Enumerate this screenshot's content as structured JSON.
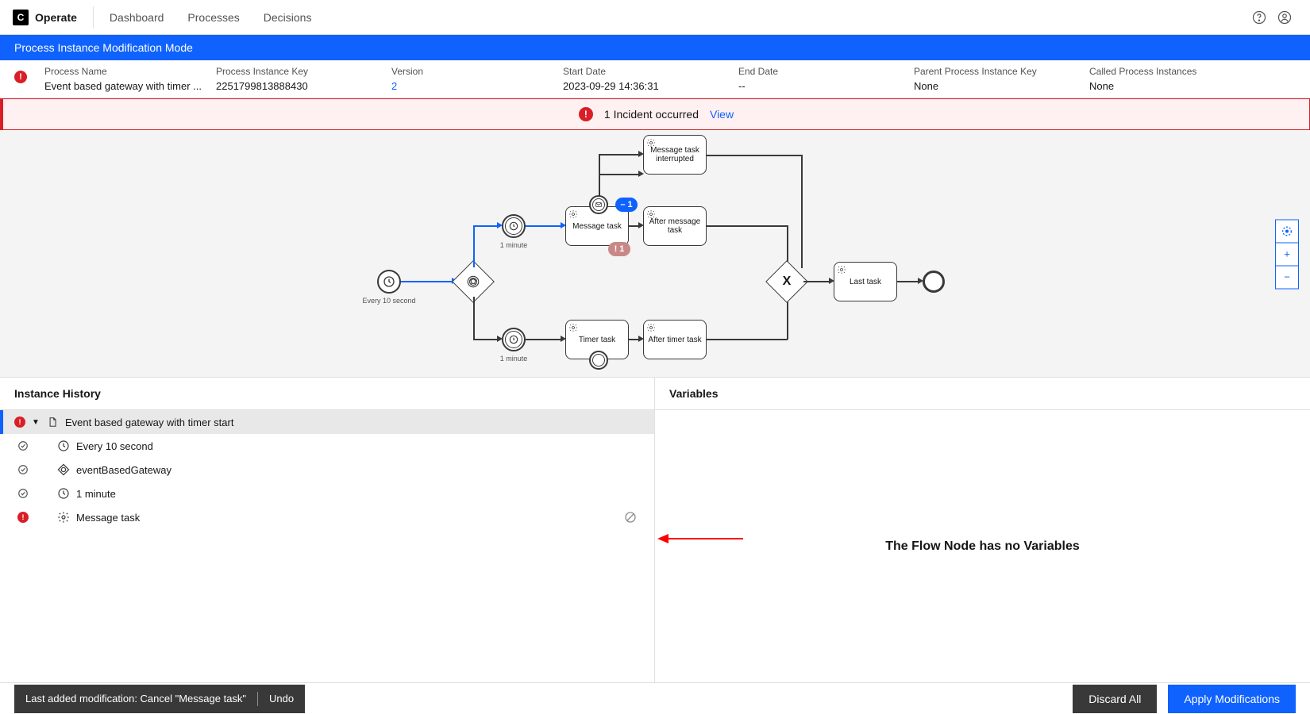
{
  "nav": {
    "brand": "Operate",
    "links": [
      "Dashboard",
      "Processes",
      "Decisions"
    ]
  },
  "modBanner": "Process Instance Modification Mode",
  "meta": {
    "processName": {
      "label": "Process Name",
      "value": "Event based gateway with timer ..."
    },
    "processInstanceKey": {
      "label": "Process Instance Key",
      "value": "2251799813888430"
    },
    "version": {
      "label": "Version",
      "value": "2"
    },
    "startDate": {
      "label": "Start Date",
      "value": "2023-09-29 14:36:31"
    },
    "endDate": {
      "label": "End Date",
      "value": "--"
    },
    "parentKey": {
      "label": "Parent Process Instance Key",
      "value": "None"
    },
    "called": {
      "label": "Called Process Instances",
      "value": "None"
    }
  },
  "incidentStrip": {
    "text": "1 Incident occurred",
    "viewLabel": "View"
  },
  "diagram": {
    "startLabel": "Every 10 second",
    "timer1Label": "1 minute",
    "timer2Label": "1 minute",
    "messageTask": "Message task",
    "messageTaskInterrupted": "Message task interrupted",
    "afterMessageTask": "After message task",
    "timerTask": "Timer task",
    "afterTimerTask": "After timer task",
    "lastTask": "Last task",
    "blueBadge": "– 1",
    "redBadge": "1"
  },
  "historyPanel": {
    "title": "Instance History",
    "root": "Event based gateway with timer start",
    "items": [
      {
        "status": "ok",
        "icon": "clock",
        "label": "Every 10 second"
      },
      {
        "status": "ok",
        "icon": "diamond",
        "label": "eventBasedGateway"
      },
      {
        "status": "ok",
        "icon": "clock",
        "label": "1 minute"
      },
      {
        "status": "err",
        "icon": "gear",
        "label": "Message task",
        "cancel": true
      }
    ]
  },
  "varsPanel": {
    "title": "Variables",
    "empty": "The Flow Node has no Variables"
  },
  "bottom": {
    "lastMod": "Last added modification: Cancel \"Message task\"",
    "undo": "Undo",
    "discard": "Discard All",
    "apply": "Apply Modifications"
  }
}
